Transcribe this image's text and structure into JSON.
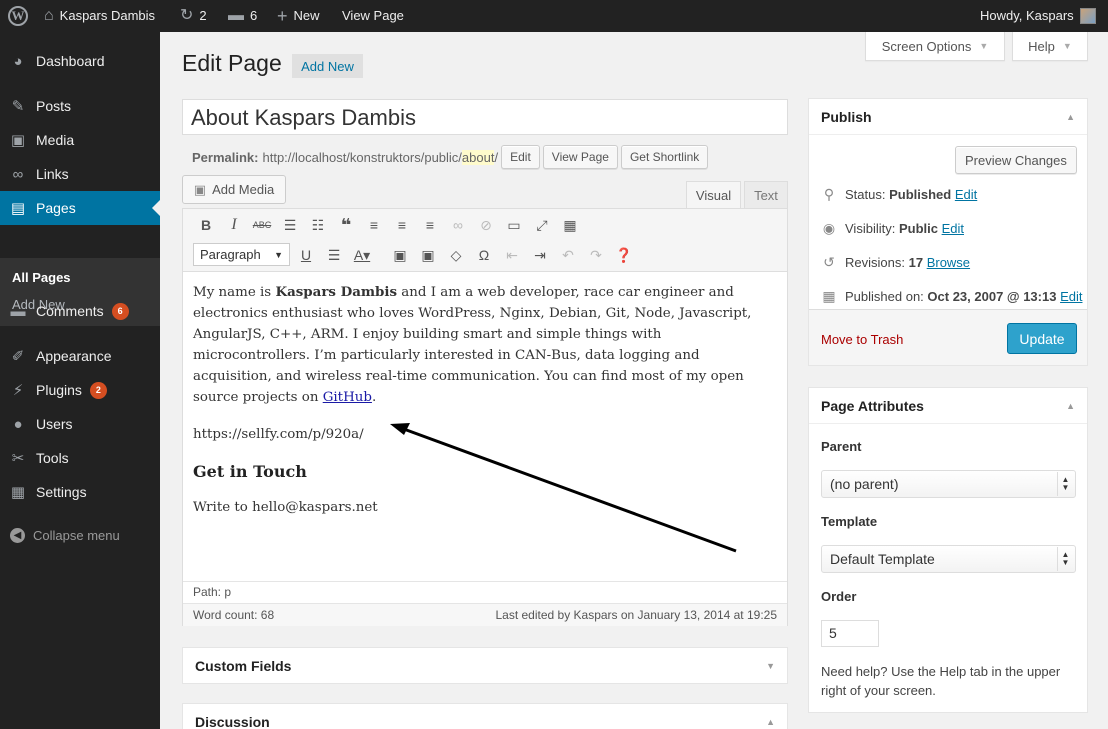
{
  "adminbar": {
    "site_name": "Kaspars Dambis",
    "updates_count": "2",
    "comments_count": "6",
    "new_label": "New",
    "view_page": "View Page",
    "howdy": "Howdy, Kaspars"
  },
  "sidebar": {
    "items": [
      {
        "label": "Dashboard",
        "icon": "dashboard-icon"
      },
      {
        "label": "Posts",
        "icon": "pin-icon"
      },
      {
        "label": "Media",
        "icon": "media-icon"
      },
      {
        "label": "Links",
        "icon": "link-icon"
      },
      {
        "label": "Pages",
        "icon": "pages-icon"
      },
      {
        "label": "Comments",
        "icon": "comment-icon",
        "badge": "6"
      },
      {
        "label": "Appearance",
        "icon": "brush-icon"
      },
      {
        "label": "Plugins",
        "icon": "plug-icon",
        "badge": "2"
      },
      {
        "label": "Users",
        "icon": "user-icon"
      },
      {
        "label": "Tools",
        "icon": "wrench-icon"
      },
      {
        "label": "Settings",
        "icon": "settings-icon"
      }
    ],
    "submenu": {
      "all_pages": "All Pages",
      "add_new": "Add New"
    },
    "collapse": "Collapse menu"
  },
  "screen_meta": {
    "screen_options": "Screen Options",
    "help": "Help"
  },
  "page": {
    "heading": "Edit Page",
    "add_new": "Add New",
    "title_value": "About Kaspars Dambis",
    "permalink_label": "Permalink:",
    "permalink_base": "http://localhost/konstruktors/public/",
    "permalink_slug": "about",
    "permalink_tail": "/",
    "edit_btn": "Edit",
    "view_page_btn": "View Page",
    "shortlink_btn": "Get Shortlink"
  },
  "editor": {
    "add_media": "Add Media",
    "tab_visual": "Visual",
    "tab_text": "Text",
    "format_select": "Paragraph",
    "p1_pre": "My name is ",
    "p1_bold": "Kaspars Dambis",
    "p1_mid": " and I am a web developer, race car engineer and electronics enthusiast who loves WordPress, Nginx, Debian, Git, Node, Javascript, AngularJS, C++, ARM. I enjoy building smart and simple things with microcontrollers. I’m particularly interested in CAN-Bus, data logging and acquisition, and wireless real-time communication. You can find most of my open source projects on ",
    "p1_link": "GitHub",
    "p1_end": ".",
    "url_line": "https://sellfy.com/p/920a/",
    "heading": "Get in Touch",
    "contact": "Write to hello@kaspars.net",
    "path": "Path: p",
    "word_count": "Word count: 68",
    "last_edited": "Last edited by Kaspars on January 13, 2014 at 19:25"
  },
  "publish": {
    "title": "Publish",
    "preview": "Preview Changes",
    "status_label": "Status:",
    "status_value": "Published",
    "visibility_label": "Visibility:",
    "visibility_value": "Public",
    "revisions_label": "Revisions:",
    "revisions_value": "17",
    "browse": "Browse",
    "published_label": "Published on:",
    "published_value": "Oct 23, 2007 @ 13:13",
    "edit": "Edit",
    "trash": "Move to Trash",
    "update": "Update"
  },
  "attributes": {
    "title": "Page Attributes",
    "parent_label": "Parent",
    "parent_value": "(no parent)",
    "template_label": "Template",
    "template_value": "Default Template",
    "order_label": "Order",
    "order_value": "5",
    "help": "Need help? Use the Help tab in the upper right of your screen."
  },
  "boxes": {
    "custom_fields": "Custom Fields",
    "discussion": "Discussion"
  }
}
